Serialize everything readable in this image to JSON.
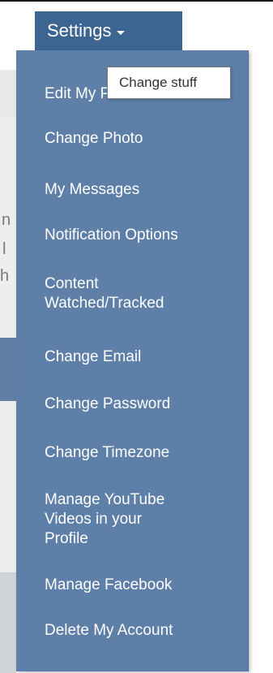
{
  "nav": {
    "settings_label": "Settings"
  },
  "tooltip": {
    "text": "Change stuff"
  },
  "menu": {
    "items": [
      {
        "label": "Edit My Profile"
      },
      {
        "label": "Change Photo"
      },
      {
        "label": "My Messages"
      },
      {
        "label": "Notification Options"
      },
      {
        "label": "Content Watched/Tracked"
      },
      {
        "label": "Change Email"
      },
      {
        "label": "Change Password"
      },
      {
        "label": "Change Timezone"
      },
      {
        "label": "Manage YouTube Videos in your Profile"
      },
      {
        "label": "Manage Facebook"
      },
      {
        "label": "Delete My Account"
      }
    ]
  },
  "background_text": {
    "fragments": [
      "n",
      "l",
      "h"
    ]
  },
  "colors": {
    "menu_background": "#5e7fa8",
    "settings_button": "#3d6591",
    "menu_text": "#ffffff"
  }
}
